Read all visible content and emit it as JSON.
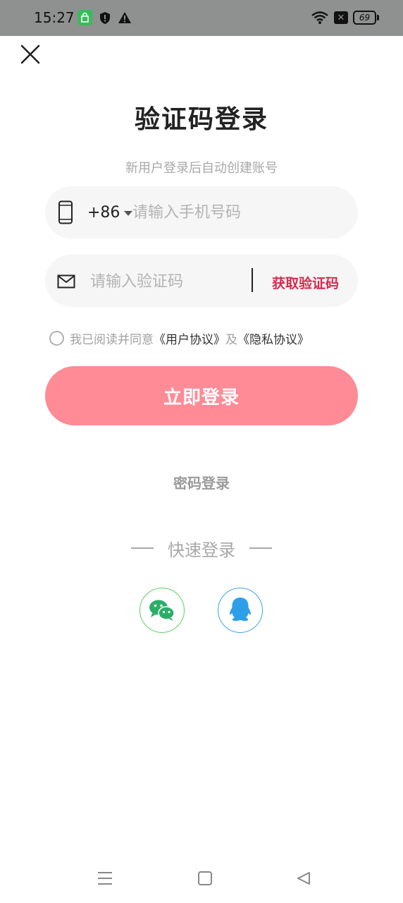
{
  "status_bar": {
    "time": "15:27",
    "battery_level": "69",
    "icons": [
      "app-notification-icon",
      "shield-icon",
      "warning-icon",
      "wifi-icon",
      "no-sim-icon",
      "battery-icon"
    ]
  },
  "header": {
    "close_icon": "close-icon"
  },
  "page": {
    "title": "验证码登录",
    "subtitle": "新用户登录后自动创建账号"
  },
  "phone_field": {
    "icon": "phone-icon",
    "country_code": "+86",
    "placeholder": "请输入手机号码",
    "value": ""
  },
  "code_field": {
    "icon": "mail-icon",
    "placeholder": "请输入验证码",
    "value": "",
    "get_code_label": "获取验证码"
  },
  "agreement": {
    "checked": false,
    "prefix": "我已阅读并同意",
    "user_agreement": "《用户协议》",
    "conjunction": "及",
    "privacy_policy": "《隐私协议》"
  },
  "login_button": {
    "label": "立即登录"
  },
  "password_login": {
    "label": "密码登录"
  },
  "quick_login": {
    "label": "快速登录",
    "providers": [
      {
        "name": "wechat",
        "icon": "wechat-icon"
      },
      {
        "name": "qq",
        "icon": "qq-icon"
      }
    ]
  },
  "colors": {
    "accent": "#fe8b96",
    "get_code": "#d62a4c",
    "wechat": "#2aae67",
    "qq": "#2e9ee8",
    "status_bar": "#8e9190"
  }
}
